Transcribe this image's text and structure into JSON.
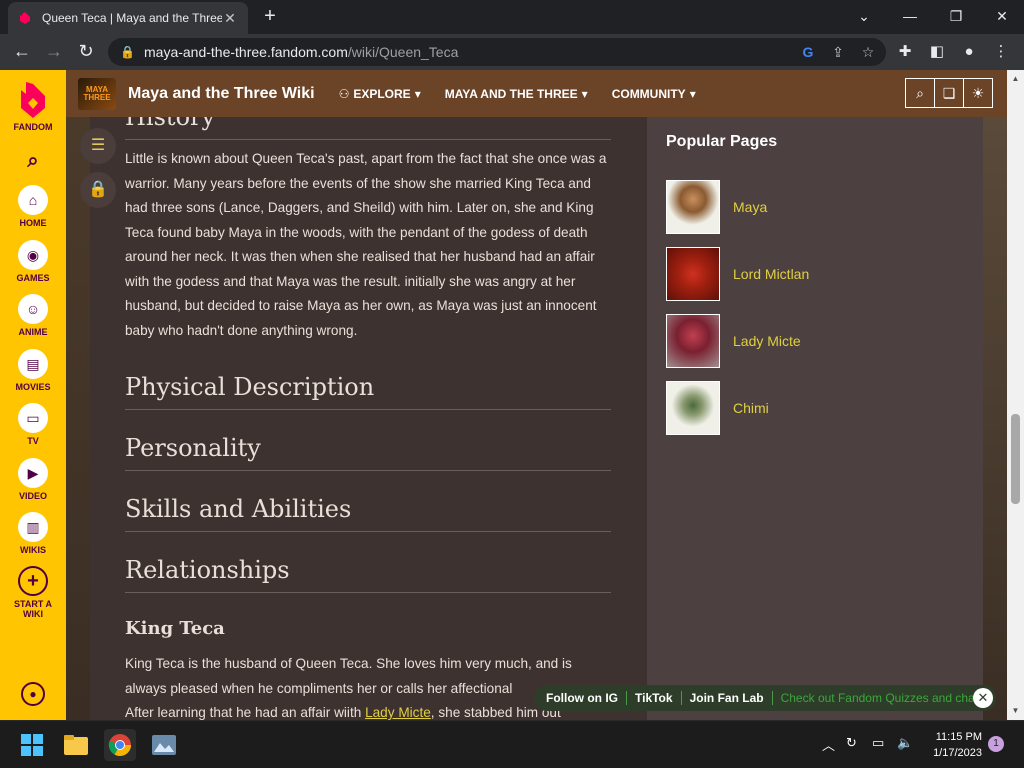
{
  "browser": {
    "tab_title": "Queen Teca | Maya and the Three",
    "tab_close": "✕",
    "new_tab": "+",
    "url_host": "maya-and-the-three.fandom.com",
    "url_path": "/wiki/Queen_Teca"
  },
  "fandom_rail": {
    "brand": "FANDOM",
    "items": [
      {
        "label": "HOME"
      },
      {
        "label": "GAMES"
      },
      {
        "label": "ANIME"
      },
      {
        "label": "MOVIES"
      },
      {
        "label": "TV"
      },
      {
        "label": "VIDEO"
      },
      {
        "label": "WIKIS"
      },
      {
        "label": "START A WIKI"
      }
    ]
  },
  "wiki_header": {
    "logo_text": "MAYA THREE",
    "wiki_name": "Maya and the Three Wiki",
    "menus": [
      "EXPLORE",
      "MAYA AND THE THREE",
      "COMMUNITY"
    ]
  },
  "article": {
    "history_heading": "History",
    "history_text": "Little is known about Queen Teca's past, apart from the fact that she once was a warrior. Many years before the events of the show she married King Teca and had three sons (Lance, Daggers, and Sheild) with him. Later on, she and King Teca found baby Maya in the woods, with the pendant of the godess of death around her neck. It was then when she realised that her husband had an affair with the godess and that Maya was the result. initially she was angry at her husband, but decided to raise Maya as her own, as Maya was just an innocent baby who hadn't done anything wrong.",
    "physical_heading": "Physical Description",
    "personality_heading": "Personality",
    "skills_heading": "Skills and Abilities",
    "relationships_heading": "Relationships",
    "king_heading": "King Teca",
    "king_text_1": "King Teca is the husband of Queen Teca. She loves him very much, and is always pleased when he compliments her or calls her affectional",
    "king_text_2a": "After learning that he had an affair wiith ",
    "king_link": "Lady Micte",
    "king_text_2b": ", she stabbed him out"
  },
  "popular": {
    "title": "Popular Pages",
    "pages": [
      {
        "name": "Maya",
        "color": "#c89060"
      },
      {
        "name": "Lord Mictlan",
        "color": "#a02010"
      },
      {
        "name": "Lady Micte",
        "color": "#7a2030"
      },
      {
        "name": "Chimi",
        "color": "#e8e8e0"
      }
    ]
  },
  "follow_bar": {
    "items": [
      "Follow on IG",
      "TikTok",
      "Join Fan Lab"
    ],
    "marquee": "Check out Fandom Quizzes and cha",
    "close": "✕"
  },
  "taskbar": {
    "time": "11:15 PM",
    "date": "1/17/2023",
    "notifications": "1"
  }
}
